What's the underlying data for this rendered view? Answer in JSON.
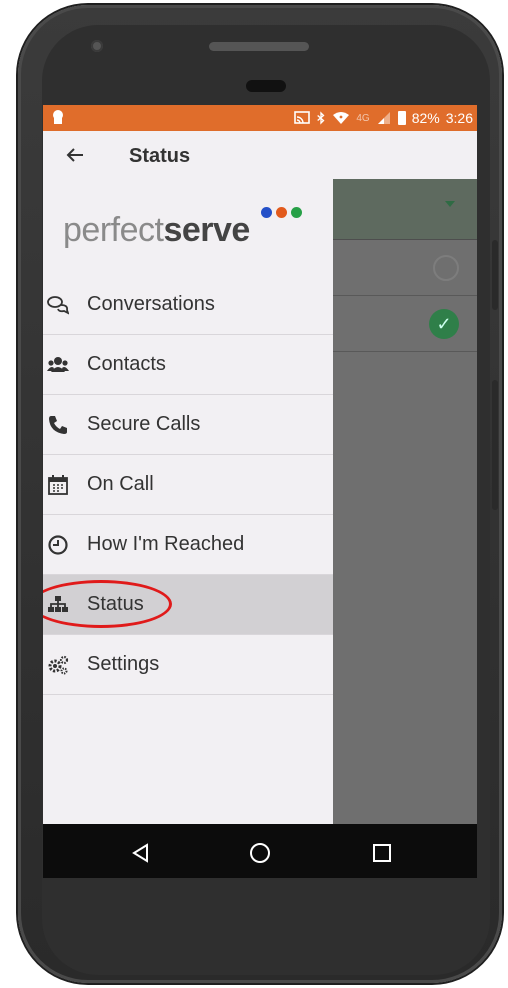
{
  "statusbar": {
    "battery": "82%",
    "time": "3:26",
    "network": "4G",
    "colors": {
      "background": "#e06d2b"
    }
  },
  "appbar": {
    "back_icon": "arrow-left-icon",
    "title": "Status"
  },
  "logo": {
    "text_light": "perfect",
    "text_bold": "serve",
    "dot_colors": [
      "#2450c8",
      "#e25a1c",
      "#27a047"
    ]
  },
  "menu": {
    "items": [
      {
        "label": "Conversations",
        "icon": "chat-bubbles-icon"
      },
      {
        "label": "Contacts",
        "icon": "users-icon"
      },
      {
        "label": "Secure Calls",
        "icon": "phone-icon"
      },
      {
        "label": "On Call",
        "icon": "calendar-icon"
      },
      {
        "label": "How I'm Reached",
        "icon": "clock-icon"
      },
      {
        "label": "Status",
        "icon": "sitemap-icon",
        "active": true
      },
      {
        "label": "Settings",
        "icon": "gears-icon"
      }
    ]
  },
  "highlight": {
    "color": "#e01a1a",
    "target": "Status"
  },
  "background_content": {
    "rows": [
      {
        "type": "dropdown"
      },
      {
        "type": "radio",
        "selected": false
      },
      {
        "type": "radio",
        "selected": true
      }
    ]
  },
  "navbar": {
    "buttons": [
      "back-triangle-icon",
      "home-circle-icon",
      "recents-square-icon"
    ]
  }
}
